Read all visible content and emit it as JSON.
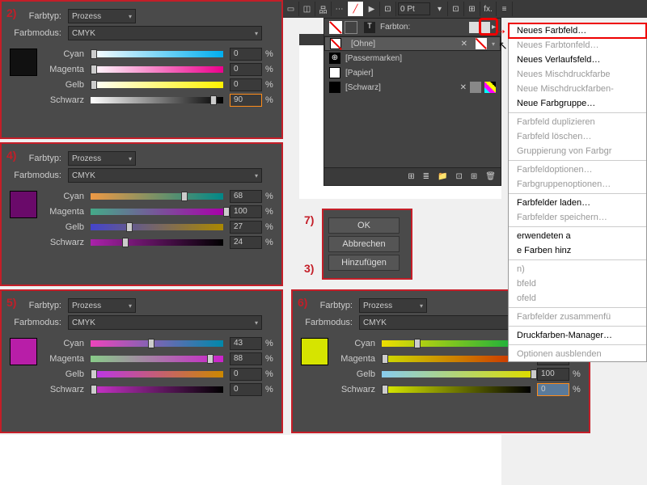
{
  "labels": {
    "farbtyp": "Farbtyp:",
    "farbmodus": "Farbmodus:",
    "prozess": "Prozess",
    "cmyk": "CMYK",
    "cyan": "Cyan",
    "magenta": "Magenta",
    "gelb": "Gelb",
    "schwarz": "Schwarz",
    "pct": "%",
    "farbton": "Farbton:"
  },
  "steps": {
    "s2": "2)",
    "s3": "3)",
    "s4": "4)",
    "s5": "5)",
    "s6": "6)",
    "s7": "7)"
  },
  "panels": {
    "p2": {
      "c": "0",
      "m": "0",
      "y": "0",
      "k": "90",
      "swatch": "#111111"
    },
    "p4": {
      "c": "68",
      "m": "100",
      "y": "27",
      "k": "24",
      "swatch": "#6a0a6a"
    },
    "p5": {
      "c": "43",
      "m": "88",
      "y": "0",
      "k": "0",
      "swatch": "#b81ea8"
    },
    "p6": {
      "c": "22",
      "m": "0",
      "y": "100",
      "k": "0",
      "swatch": "#d6e400"
    }
  },
  "buttons": {
    "ok": "OK",
    "cancel": "Abbrechen",
    "add": "Hinzufügen"
  },
  "toolbar": {
    "pt": "0 Pt"
  },
  "swatches": {
    "ohne": "[Ohne]",
    "passermarken": "[Passermarken]",
    "papier": "[Papier]",
    "schwarz": "[Schwarz]"
  },
  "menu": {
    "neues_farbfeld": "Neues Farbfeld…",
    "neues_farbtonfeld": "Neues Farbtonfeld…",
    "neues_verlaufsfeld": "Neues Verlaufsfeld…",
    "neues_mischdruckfarbe": "Neues Mischdruckfarbe",
    "neue_mischdruckfarben": "Neue Mischdruckfarben-",
    "neue_farbgruppe": "Neue Farbgruppe…",
    "farbfeld_duplizieren": "Farbfeld duplizieren",
    "farbfeld_loeschen": "Farbfeld löschen…",
    "gruppierung": "Gruppierung von Farbgr",
    "farbfeldoptionen": "Farbfeldoptionen…",
    "farbgruppenoptionen": "Farbgruppenoptionen…",
    "farbfelder_laden": "Farbfelder laden…",
    "farbfelder_speichern": "Farbfelder speichern…",
    "verwendeten": "erwendeten a",
    "farben_hinz": "e Farben hinz",
    "n": "n)",
    "bfeld": "bfeld",
    "ofeld": "ofeld",
    "farbfelder_zusammen": "Farbfelder zusammenfü",
    "druckfarben": "Druckfarben-Manager…",
    "optionen": "Optionen ausblenden"
  }
}
